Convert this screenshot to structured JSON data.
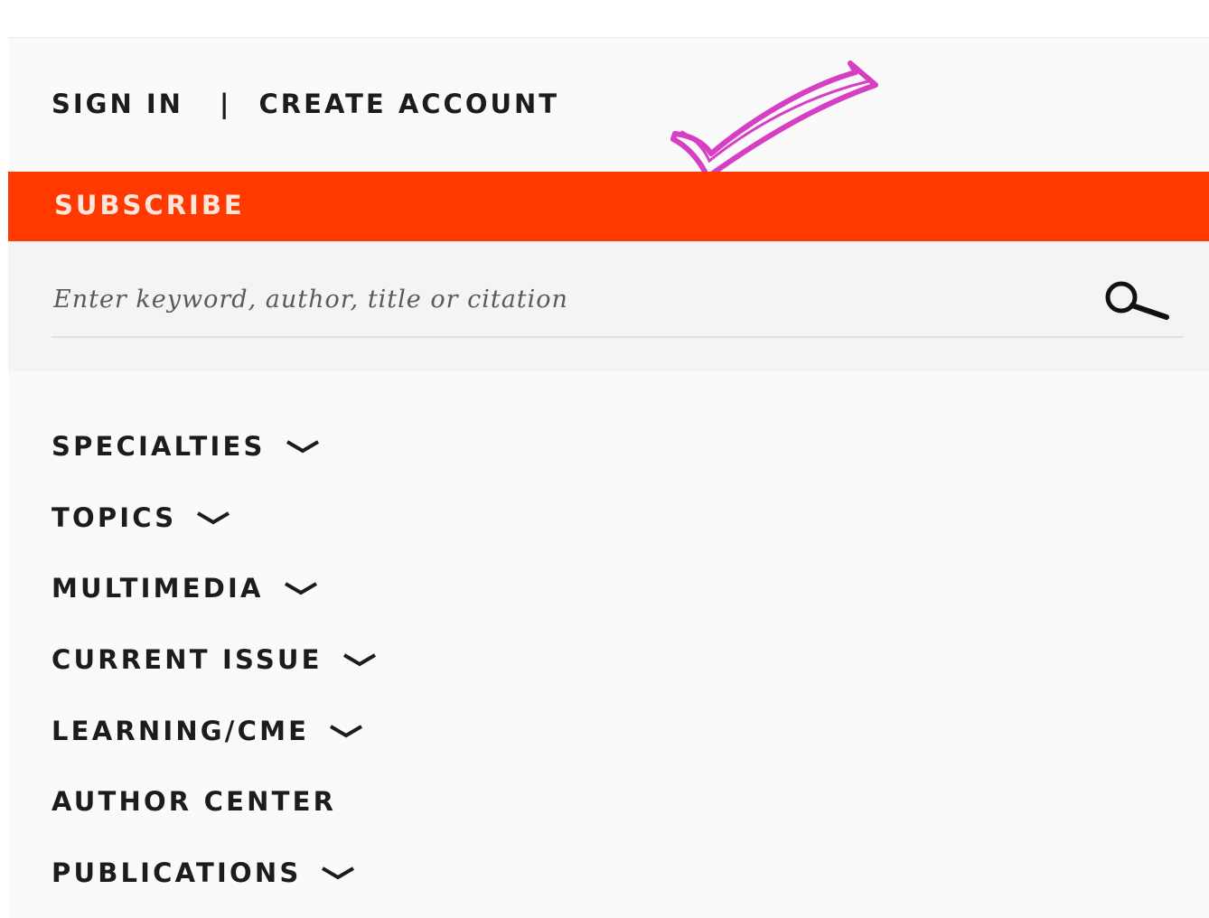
{
  "account": {
    "sign_in": "SIGN IN",
    "separator": "|",
    "create_account": "CREATE ACCOUNT"
  },
  "subscribe": {
    "label": "SUBSCRIBE",
    "color": "#ff3900"
  },
  "search": {
    "placeholder": "Enter keyword, author, title or citation",
    "value": "",
    "icon": "search-icon"
  },
  "nav": {
    "items": [
      {
        "label": "SPECIALTIES",
        "has_dropdown": true
      },
      {
        "label": "TOPICS",
        "has_dropdown": true
      },
      {
        "label": "MULTIMEDIA",
        "has_dropdown": true
      },
      {
        "label": "CURRENT ISSUE",
        "has_dropdown": true
      },
      {
        "label": "LEARNING/CME",
        "has_dropdown": true
      },
      {
        "label": "AUTHOR CENTER",
        "has_dropdown": false
      },
      {
        "label": "PUBLICATIONS",
        "has_dropdown": true
      }
    ]
  },
  "annotation": {
    "icon": "checkmark-icon",
    "color": "#d63ec4"
  }
}
